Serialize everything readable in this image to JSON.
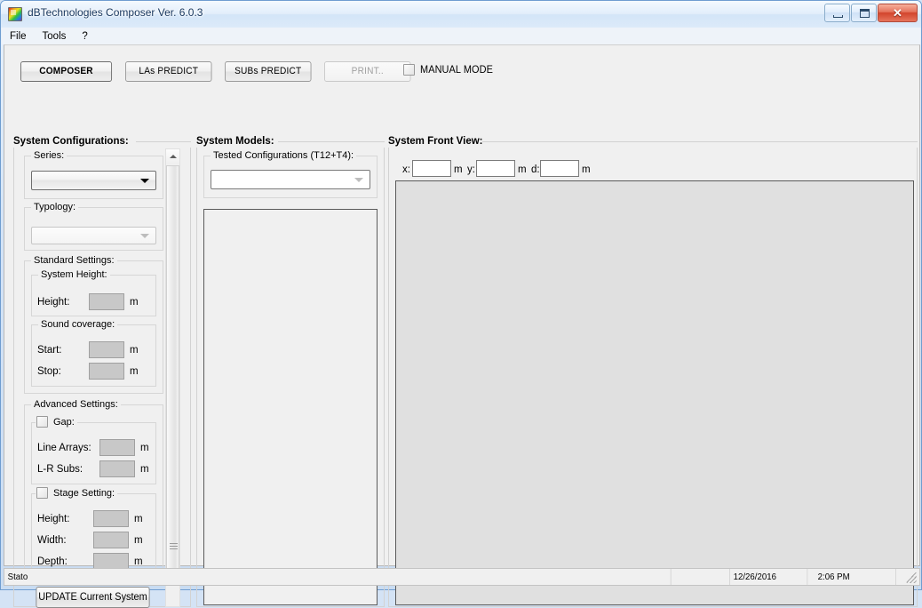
{
  "window": {
    "title": "dBTechnologies Composer Ver. 6.0.3",
    "icon": "app-logo-icon",
    "minimize_label": "",
    "maximize_label": "",
    "close_label": "✕"
  },
  "menu": {
    "items": [
      {
        "label": "File"
      },
      {
        "label": "Tools"
      },
      {
        "label": "?"
      }
    ]
  },
  "toolbar": {
    "tabs": [
      {
        "label": "COMPOSER",
        "state": "active"
      },
      {
        "label": "LAs PREDICT",
        "state": "normal"
      },
      {
        "label": "SUBs PREDICT",
        "state": "normal"
      },
      {
        "label": "PRINT..",
        "state": "disabled"
      }
    ],
    "manual_mode_label": "MANUAL MODE",
    "manual_mode_checked": false
  },
  "system_configurations": {
    "heading": "System Configurations:",
    "series": {
      "group_label": "Series:",
      "value": "",
      "placeholder": "",
      "enabled": true
    },
    "typology": {
      "group_label": "Typology:",
      "value": "",
      "placeholder": "",
      "enabled": false
    },
    "standard_settings": {
      "group_label": "Standard Settings:",
      "system_height": {
        "group_label": "System Height:",
        "height_label": "Height:",
        "height_value": "",
        "height_unit": "m"
      },
      "sound_coverage": {
        "group_label": "Sound coverage:",
        "start_label": "Start:",
        "start_value": "",
        "start_unit": "m",
        "stop_label": "Stop:",
        "stop_value": "",
        "stop_unit": "m"
      }
    },
    "advanced_settings": {
      "group_label": "Advanced Settings:",
      "gap": {
        "group_label": "Gap:",
        "checked": false,
        "line_arrays_label": "Line Arrays:",
        "line_arrays_value": "",
        "line_arrays_unit": "m",
        "lr_subs_label": "L-R Subs:",
        "lr_subs_value": "",
        "lr_subs_unit": "m"
      },
      "stage_setting": {
        "group_label": "Stage Setting:",
        "checked": false,
        "height_label": "Height:",
        "height_value": "",
        "height_unit": "m",
        "width_label": "Width:",
        "width_value": "",
        "width_unit": "m",
        "depth_label": "Depth:",
        "depth_value": "",
        "depth_unit": "m"
      }
    },
    "update_button_label": "UPDATE Current System"
  },
  "system_models": {
    "heading": "System Models:",
    "tested_configurations": {
      "group_label": "Tested Configurations (T12+T4):",
      "value": "",
      "enabled": false
    },
    "models_list": {
      "items": []
    }
  },
  "system_front_view": {
    "heading": "System Front View:",
    "coords": {
      "x_label": "x:",
      "x_value": "",
      "x_unit": "m",
      "y_label": "y:",
      "y_value": "",
      "y_unit": "m",
      "d_label": "d:",
      "d_value": "",
      "d_unit": "m"
    }
  },
  "statusbar": {
    "status": "Stato",
    "date": "12/26/2016",
    "time": "2:06 PM"
  },
  "colors": {
    "window_frame": "#6f9dd0",
    "title_text": "#17365d",
    "close_button": "#d2442c",
    "client_background": "#f0f0f0",
    "disabled_field": "#c8c8c8",
    "draw_area": "#e0e0e0"
  }
}
